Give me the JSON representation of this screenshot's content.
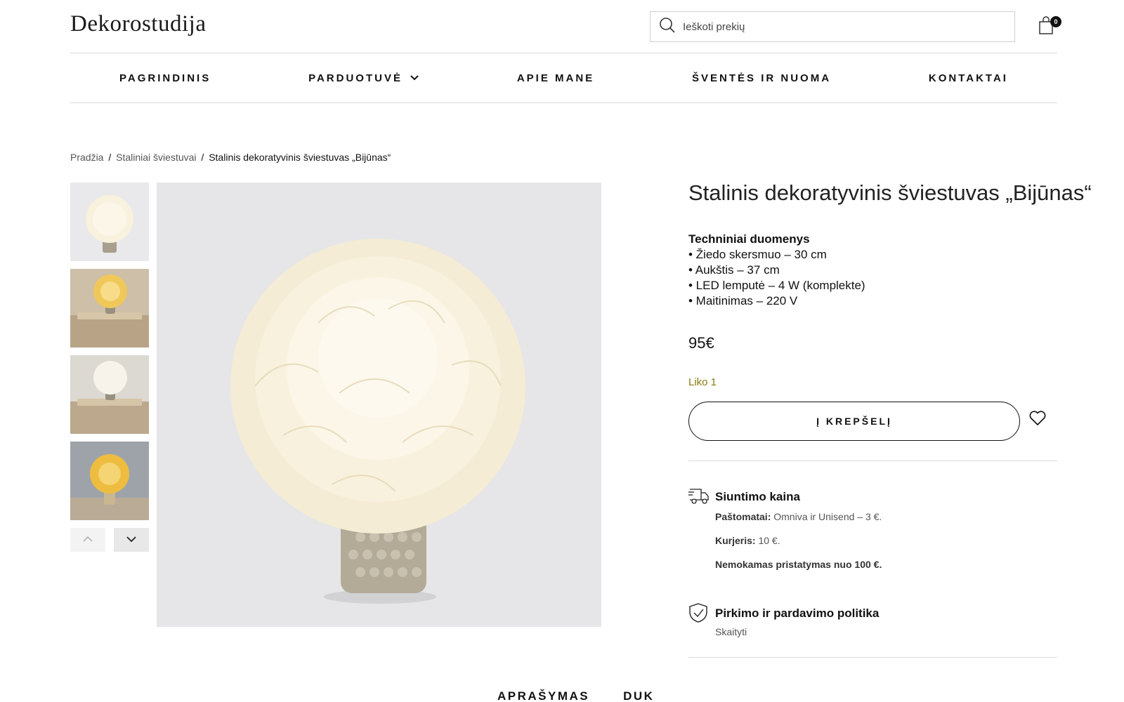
{
  "header": {
    "logo": "Dekorostudija",
    "search_placeholder": "Ieškoti prekių",
    "cart_count": "0"
  },
  "nav": {
    "items": [
      {
        "label": "PAGRINDINIS"
      },
      {
        "label": "PARDUOTUVĖ"
      },
      {
        "label": "APIE MANE"
      },
      {
        "label": "ŠVENTĖS IR NUOMA"
      },
      {
        "label": "KONTAKTAI"
      }
    ]
  },
  "breadcrumb": {
    "home": "Pradžia",
    "sep": "/",
    "category": "Staliniai šviestuvai",
    "current": "Stalinis dekoratyvinis šviestuvas „Bijūnas“"
  },
  "product": {
    "title": "Stalinis dekoratyvinis šviestuvas „Bijūnas“",
    "specs_heading": "Techniniai duomenys",
    "specs": [
      "• Žiedo skersmuo – 30 cm",
      "• Aukštis – 37 cm",
      "• LED lemputė – 4 W (komplekte)",
      "• Maitinimas – 220 V"
    ],
    "price": "95€",
    "stock": "Liko 1",
    "add_to_cart": "Į KREPŠELĮ"
  },
  "shipping": {
    "title": "Siuntimo kaina",
    "parcel_label": "Paštomatai:",
    "parcel_value": "Omniva ir Unisend – 3 €.",
    "courier_label": "Kurjeris:",
    "courier_value": "10 €.",
    "free": "Nemokamas pristatymas nuo 100 €."
  },
  "policy": {
    "title": "Pirkimo ir pardavimo politika",
    "link": "Skaityti"
  },
  "tabs": [
    "APRAŠYMAS",
    "DUK"
  ],
  "colors": {
    "stock": "#8a7a10",
    "image_bg": "#e6e6e8",
    "flower": "#f7efd8"
  },
  "icons": [
    "search-icon",
    "bag-icon",
    "chevron-down-icon",
    "chevron-up-icon",
    "heart-icon",
    "truck-icon",
    "shield-check-icon"
  ]
}
